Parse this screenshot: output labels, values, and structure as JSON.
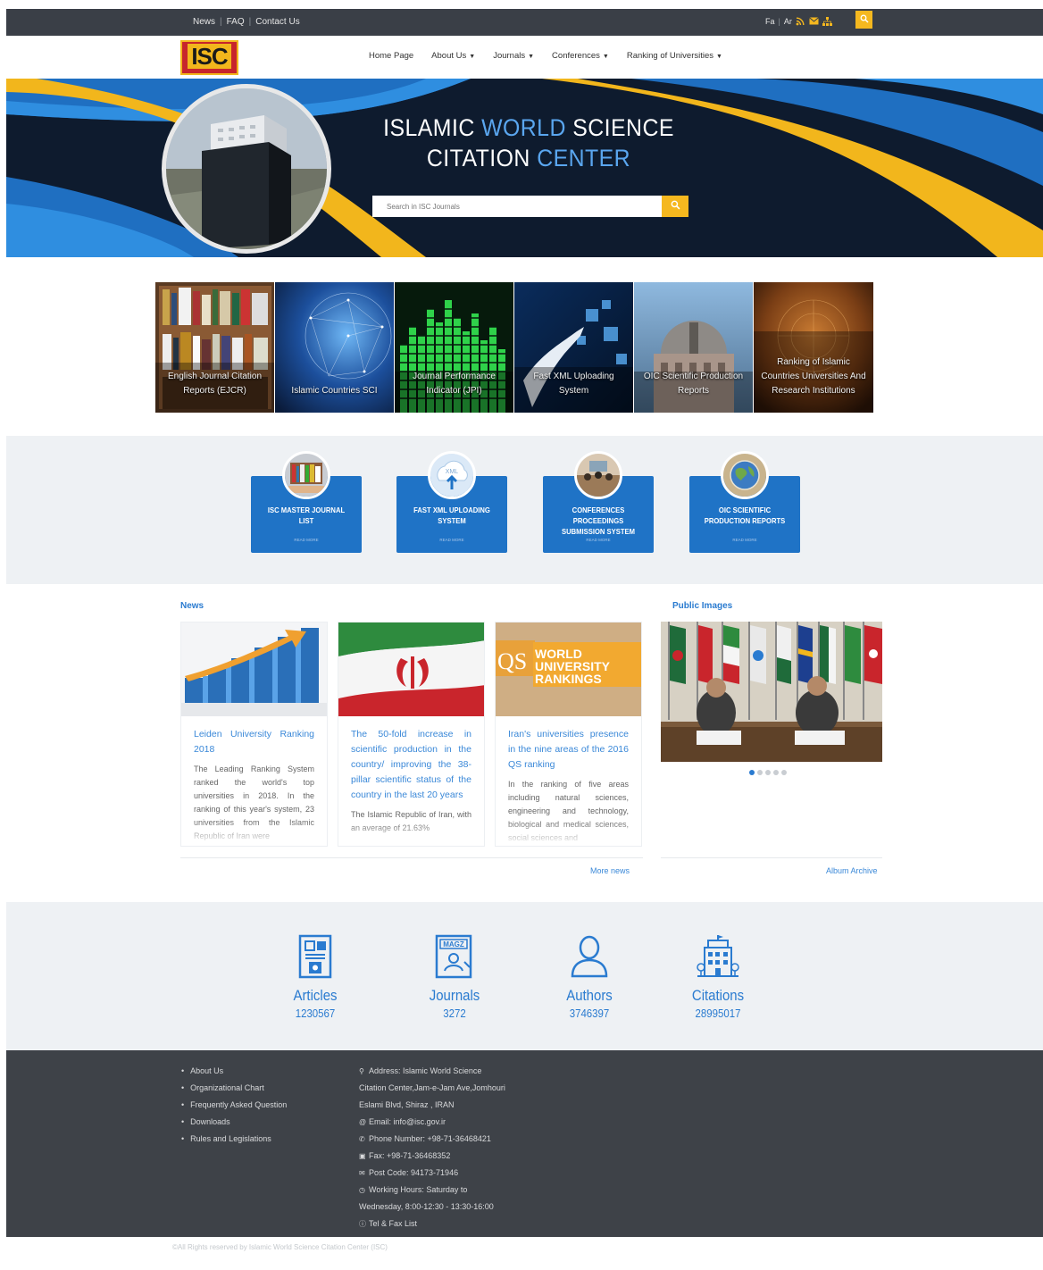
{
  "topbar": {
    "links": [
      "News",
      "FAQ",
      "Contact Us"
    ],
    "languages": [
      "Fa",
      "Ar"
    ],
    "icons": [
      "rss-icon",
      "mail-icon",
      "sitemap-icon",
      "search-icon"
    ]
  },
  "header": {
    "logo_text": "ISC",
    "nav": [
      {
        "label": "Home Page",
        "dropdown": false
      },
      {
        "label": "About Us",
        "dropdown": true
      },
      {
        "label": "Journals",
        "dropdown": true
      },
      {
        "label": "Conferences",
        "dropdown": true
      },
      {
        "label": "Ranking of Universities",
        "dropdown": true
      }
    ]
  },
  "hero": {
    "title_line1_a": "ISLAMIC",
    "title_line1_b": "WORLD",
    "title_line1_c": "SCIENCE",
    "title_line2_a": "CITATION",
    "title_line2_b": "CENTER",
    "search_placeholder": "Search in ISC Journals"
  },
  "tiles": [
    {
      "label": "English Journal Citation Reports (EJCR)"
    },
    {
      "label": "Islamic Countries SCI"
    },
    {
      "label": "Journal Performance Indicator (JPI)"
    },
    {
      "label": "Fast XML Uploading System"
    },
    {
      "label": "OIC Scientific Production Reports"
    },
    {
      "label": "Ranking of Islamic Countries Universities And Research Institutions"
    }
  ],
  "services": [
    {
      "title": "ISC MASTER JOURNAL LIST",
      "more": "READ MORE"
    },
    {
      "title": "FAST XML UPLOADING SYSTEM",
      "more": "READ MORE",
      "badge": "XML"
    },
    {
      "title": "CONFERENCES PROCEEDINGS SUBMISSION SYSTEM",
      "more": "READ MORE"
    },
    {
      "title": "OIC SCIENTIFIC PRODUCTION REPORTS",
      "more": "READ MORE"
    }
  ],
  "news": {
    "title": "News",
    "items": [
      {
        "title": "Leiden University Ranking 2018",
        "text": "The Leading Ranking System ranked the world's top universities in 2018. In the ranking of this year's system, 23 universities from the Islamic Republic of Iran were"
      },
      {
        "title": "The 50-fold increase in scientific production in the country/ improving the 38-pillar scientific status of the country in the last 20 years",
        "text": "The Islamic Republic of Iran, with an average of 21.63%"
      },
      {
        "title": "Iran's universities presence in the nine areas of the 2016 QS ranking",
        "text": "In the ranking of five areas including natural sciences, engineering and technology, biological and medical sciences, social sciences and",
        "image_text": [
          "QS",
          "WORLD",
          "UNIVERSITY",
          "RANKINGS"
        ]
      }
    ],
    "more": "More news"
  },
  "public_images": {
    "title": "Public Images",
    "slide_count": 5,
    "active_slide": 0,
    "archive": "Album Archive"
  },
  "stats": [
    {
      "label": "Articles",
      "value": "1230567",
      "icon": "article-icon"
    },
    {
      "label": "Journals",
      "value": "3272",
      "icon": "magazine-icon",
      "icon_text": "MAGZ"
    },
    {
      "label": "Authors",
      "value": "3746397",
      "icon": "user-icon"
    },
    {
      "label": "Citations",
      "value": "28995017",
      "icon": "building-icon"
    }
  ],
  "footer": {
    "links": [
      "About Us",
      "Organizational Chart",
      "Frequently Asked Question",
      "Downloads",
      "Rules and Legislations"
    ],
    "address_lines": [
      "Address: Islamic World Science",
      "Citation Center,Jam-e-Jam Ave,Jomhouri",
      "Eslami Blvd, Shiraz , IRAN"
    ],
    "email": "Email: info@isc.gov.ir",
    "phone": "Phone Number: +98-71-36468421",
    "fax": "Fax: +98-71-36468352",
    "post": "Post Code: 94173-71946",
    "hours_1": "Working Hours: Saturday to",
    "hours_2": "Wednesday, 8:00-12:30 - 13:30-16:00",
    "tel_fax": "Tel & Fax List",
    "copyright": "©All Rights reserved by Islamic World Science Citation Center (ISC)"
  },
  "colors": {
    "accent_blue": "#2a7bd0",
    "card_blue": "#1f73c6",
    "accent_yellow": "#f5b81f",
    "topbar": "#3a3f47",
    "footer": "#3e4248",
    "hero_dark": "#0e1b2e"
  }
}
